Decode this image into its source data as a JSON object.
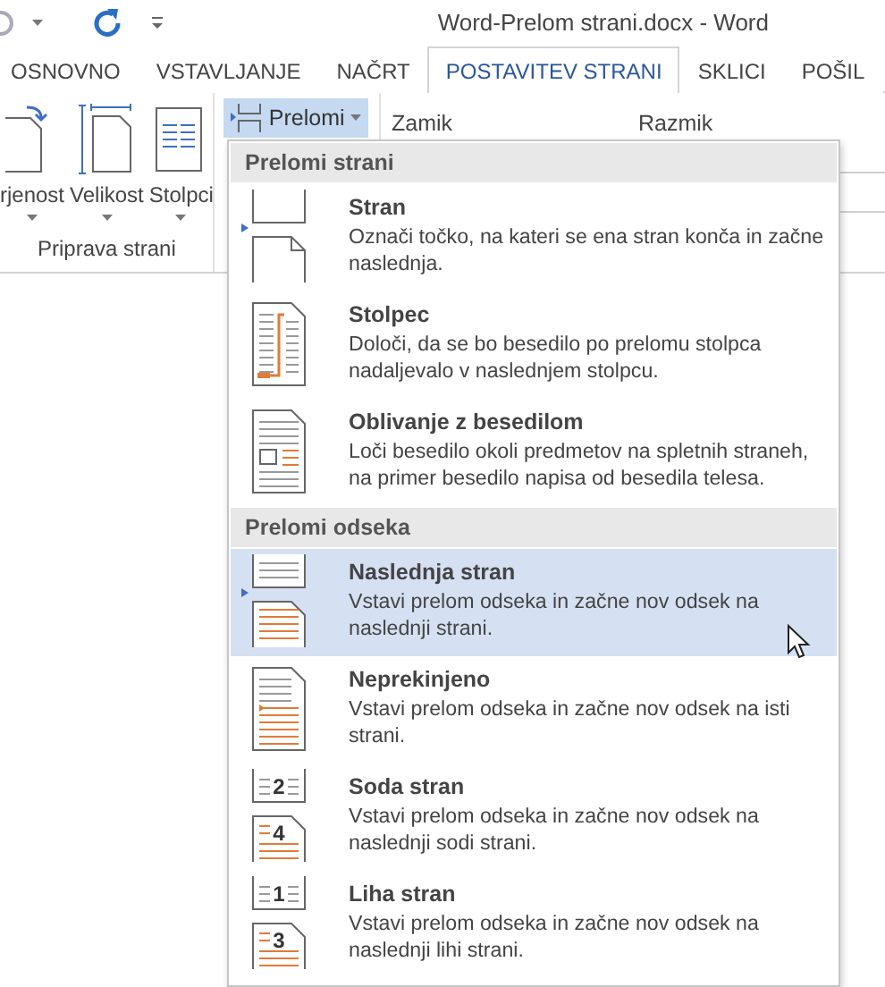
{
  "title_bar": {
    "title": "Word-Prelom strani.docx - Word"
  },
  "tabs": [
    {
      "label": "OSNOVNO",
      "selected": false
    },
    {
      "label": "VSTAVLJANJE",
      "selected": false
    },
    {
      "label": "NAČRT",
      "selected": false
    },
    {
      "label": "POSTAVITEV STRANI",
      "selected": true
    },
    {
      "label": "SKLICI",
      "selected": false
    },
    {
      "label": "POŠIL",
      "selected": false
    }
  ],
  "ribbon": {
    "buttons": [
      {
        "label": "rjenost",
        "kind": "orientation"
      },
      {
        "label": "Velikost",
        "kind": "size"
      },
      {
        "label": "Stolpci",
        "kind": "columns"
      }
    ],
    "group_label": "Priprava strani",
    "breaks_button": {
      "label": "Prelomi",
      "expanded": true
    },
    "labels": [
      "Zamik",
      "Razmik"
    ]
  },
  "menu": {
    "sections": [
      {
        "heading": "Prelomi strani",
        "items": [
          {
            "kind": "page",
            "title": "Stran",
            "description": "Označi točko, na kateri se ena stran konča in začne naslednja.",
            "selected": false
          },
          {
            "kind": "column",
            "title": "Stolpec",
            "description": "Določi, da se bo besedilo po prelomu stolpca nadaljevalo v naslednjem stolpcu.",
            "selected": false
          },
          {
            "kind": "wrapping",
            "title": "Oblivanje z besedilom",
            "description": "Loči besedilo okoli predmetov na spletnih straneh, na primer besedilo napisa od besedila telesa.",
            "selected": false
          }
        ]
      },
      {
        "heading": "Prelomi odseka",
        "items": [
          {
            "kind": "next_page",
            "title": "Naslednja stran",
            "description": "Vstavi prelom odseka in začne nov odsek na naslednji strani.",
            "selected": true
          },
          {
            "kind": "continuous",
            "title": "Neprekinjeno",
            "description": "Vstavi prelom odseka in začne nov odsek na isti strani.",
            "selected": false
          },
          {
            "kind": "numbered",
            "title": "Soda stran",
            "description": "Vstavi prelom odseka in začne nov odsek na naslednji sodi strani.",
            "page_numbers": [
              "2",
              "4"
            ],
            "selected": false
          },
          {
            "kind": "numbered",
            "title": "Liha stran",
            "description": "Vstavi prelom odseka in začne nov odsek na naslednji lihi strani.",
            "page_numbers": [
              "1",
              "3"
            ],
            "selected": false
          }
        ]
      }
    ]
  }
}
